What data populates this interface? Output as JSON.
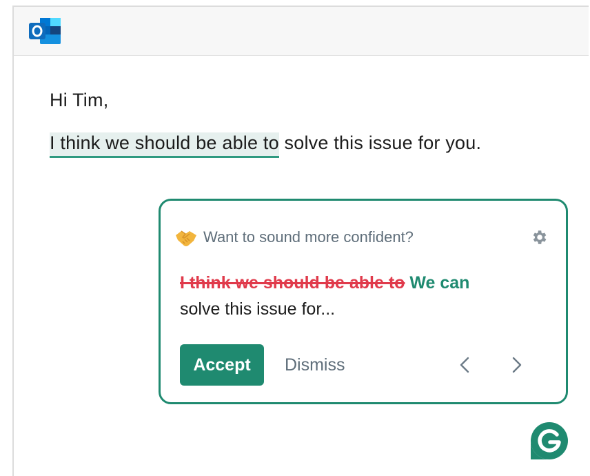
{
  "email": {
    "greeting": "Hi Tim,",
    "highlighted_phrase": "I think we should be able to",
    "rest_of_sentence": " solve this issue for you."
  },
  "suggestion_card": {
    "prompt": "Want to sound more confident?",
    "removed_text": "I think we should be able to",
    "replacement_text": "We can",
    "continuation": "solve this issue for...",
    "accept_label": "Accept",
    "dismiss_label": "Dismiss",
    "icons": {
      "tone": "handshake-icon",
      "settings": "gear-icon",
      "previous": "chevron-left-icon",
      "next": "chevron-right-icon"
    }
  },
  "branding": {
    "app_icon": "outlook-icon",
    "assistant_badge": "grammarly-icon"
  },
  "colors": {
    "accent": "#1f8a70",
    "highlight_bg": "#e6f0ee",
    "deletion": "#e03a4b",
    "outlook_blue": "#0f6cbd"
  }
}
